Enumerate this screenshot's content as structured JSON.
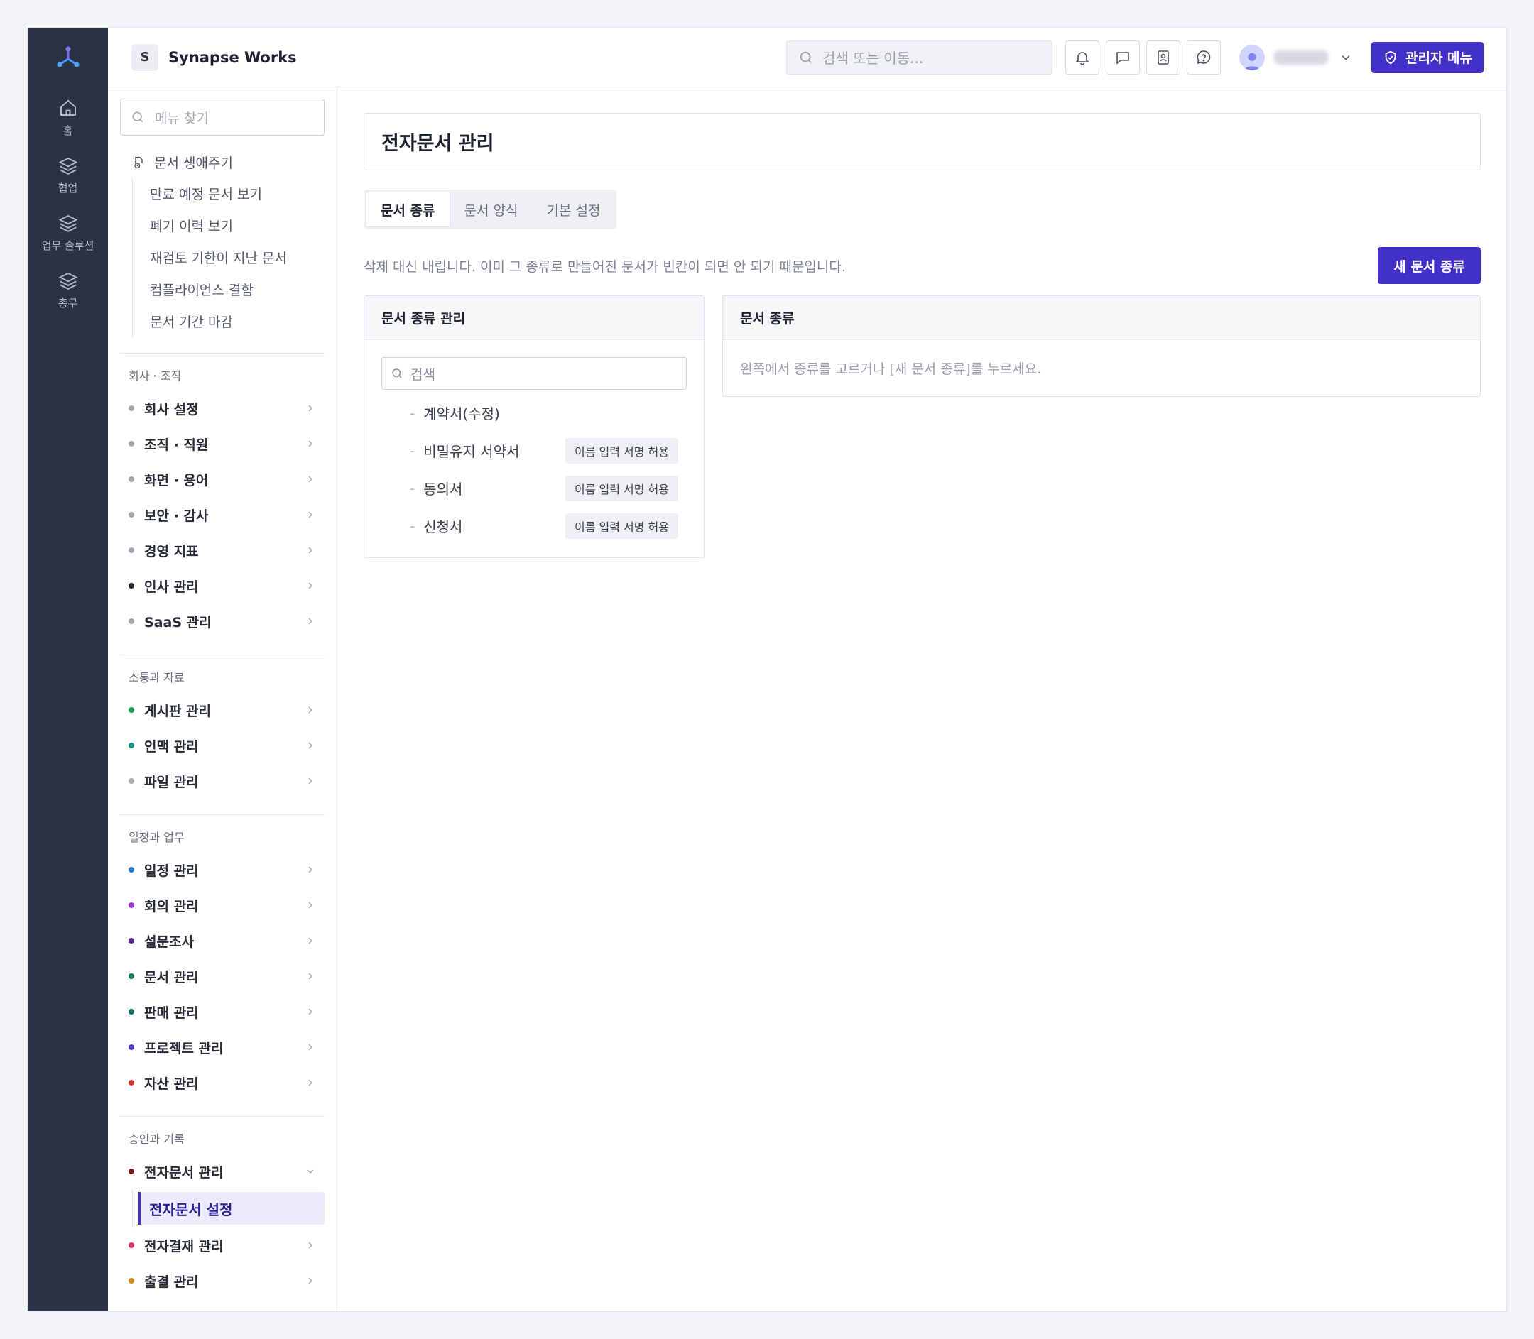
{
  "rail": {
    "items": [
      {
        "label": "홈",
        "icon": "home-icon"
      },
      {
        "label": "협업",
        "icon": "layers-icon"
      },
      {
        "label": "업무 솔루션",
        "icon": "layers-icon"
      },
      {
        "label": "총무",
        "icon": "layers-icon"
      }
    ]
  },
  "header": {
    "org_initial": "S",
    "org_name": "Synapse Works",
    "search_placeholder": "검색 또는 이동...",
    "admin_label": "관리자 메뉴"
  },
  "sidebar": {
    "search_placeholder": "메뉴 찾기",
    "lifecycle": {
      "title": "문서 생애주기",
      "items": [
        "만료 예정 문서 보기",
        "폐기 이력 보기",
        "재검토 기한이 지난 문서",
        "컴플라이언스 결함",
        "문서 기간 마감"
      ]
    },
    "sections": [
      {
        "title": "회사 · 조직",
        "items": [
          {
            "label": "회사 설정",
            "color": "#a3a8b5"
          },
          {
            "label": "조직 · 직원",
            "color": "#a3a8b5"
          },
          {
            "label": "화면 · 용어",
            "color": "#a3a8b5"
          },
          {
            "label": "보안 · 감사",
            "color": "#a3a8b5"
          },
          {
            "label": "경영 지표",
            "color": "#a3a8b5"
          },
          {
            "label": "인사 관리",
            "color": "#1f2430"
          },
          {
            "label": "SaaS 관리",
            "color": "#a3a8b5"
          }
        ]
      },
      {
        "title": "소통과 자료",
        "items": [
          {
            "label": "게시판 관리",
            "color": "#1a9a5a"
          },
          {
            "label": "인맥 관리",
            "color": "#14958a"
          },
          {
            "label": "파일 관리",
            "color": "#a3a8b5"
          }
        ]
      },
      {
        "title": "일정과 업무",
        "items": [
          {
            "label": "일정 관리",
            "color": "#1e7ec8"
          },
          {
            "label": "회의 관리",
            "color": "#9b3ad6"
          },
          {
            "label": "설문조사",
            "color": "#5a2a8a"
          },
          {
            "label": "문서 관리",
            "color": "#137a4d"
          },
          {
            "label": "판매 관리",
            "color": "#0f6e68"
          },
          {
            "label": "프로젝트 관리",
            "color": "#4a3fd0"
          },
          {
            "label": "자산 관리",
            "color": "#d0342c"
          }
        ]
      },
      {
        "title": "승인과 기록",
        "items": [
          {
            "label": "전자문서 관리",
            "color": "#7a1e1e"
          },
          {
            "label": "전자결재 관리",
            "color": "#e0306a"
          },
          {
            "label": "출결 관리",
            "color": "#d18c1a"
          }
        ],
        "active_sub": "전자문서 설정"
      }
    ]
  },
  "main": {
    "title": "전자문서 관리",
    "tabs": [
      "문서 종류",
      "문서 양식",
      "기본 설정"
    ],
    "active_tab": 0,
    "info_text": "삭제 대신 내립니다. 이미 그 종류로 만들어진 문서가 빈칸이 되면 안 되기 때문입니다.",
    "new_button": "새 문서 종류",
    "left_panel": {
      "title": "문서 종류 관리",
      "search_placeholder": "검색",
      "dash": "-",
      "types": [
        {
          "name": "계약서(수정)",
          "badge": ""
        },
        {
          "name": "비밀유지 서약서",
          "badge": "이름 입력 서명 허용"
        },
        {
          "name": "동의서",
          "badge": "이름 입력 서명 허용"
        },
        {
          "name": "신청서",
          "badge": "이름 입력 서명 허용"
        }
      ]
    },
    "right_panel": {
      "title": "문서 종류",
      "hint": "왼쪽에서 종류를 고르거나 [새 문서 종류]를 누르세요."
    }
  },
  "colors": {
    "accent": "#4231c9",
    "rail_bg": "#2a3346"
  }
}
